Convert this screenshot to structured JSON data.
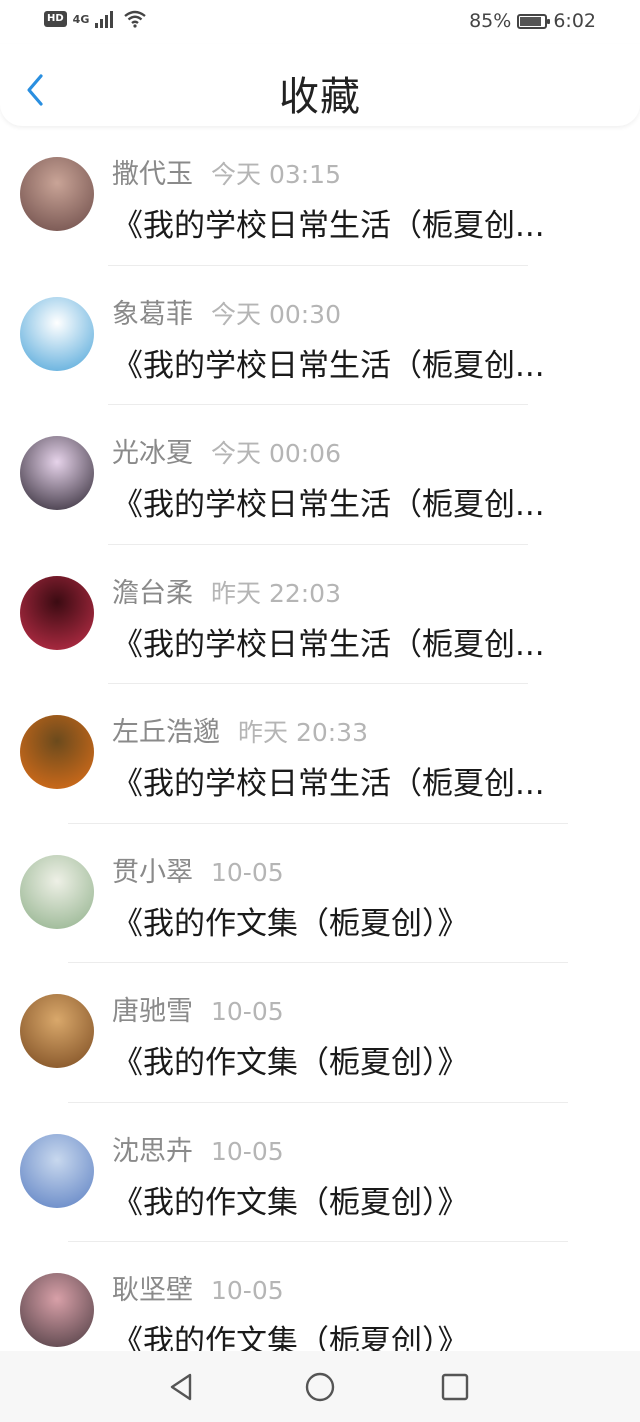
{
  "status_bar": {
    "hd": "HD",
    "network": "4G",
    "battery_percent": "85%",
    "battery_level": 0.85,
    "time": "6:02"
  },
  "header": {
    "title": "收藏",
    "back_icon": "chevron-left-icon"
  },
  "favorites": [
    {
      "name": "撒代玉",
      "time": "今天 03:15",
      "work": "《我的学校日常生活（栀夏创...",
      "avatar_colors": [
        "#c9a497",
        "#6b4a47"
      ]
    },
    {
      "name": "象葛菲",
      "time": "今天 00:30",
      "work": "《我的学校日常生活（栀夏创...",
      "avatar_colors": [
        "#ffffff",
        "#4aa3d8"
      ]
    },
    {
      "name": "光冰夏",
      "time": "今天 00:06",
      "work": "《我的学校日常生活（栀夏创...",
      "avatar_colors": [
        "#e6d3ea",
        "#2b2430"
      ]
    },
    {
      "name": "澹台柔",
      "time": "昨天 22:03",
      "work": "《我的学校日常生活（栀夏创...",
      "avatar_colors": [
        "#3b0b12",
        "#c2304a"
      ]
    },
    {
      "name": "左丘浩邈",
      "time": "昨天 20:33",
      "work": "《我的学校日常生活（栀夏创...",
      "avatar_colors": [
        "#6b4a1c",
        "#e0701a"
      ]
    },
    {
      "name": "贯小翠",
      "time": "10-05",
      "work": "《我的作文集（栀夏创）》",
      "avatar_colors": [
        "#eef0e6",
        "#8fb08a"
      ]
    },
    {
      "name": "唐驰雪",
      "time": "10-05",
      "work": "《我的作文集（栀夏创）》",
      "avatar_colors": [
        "#d9a86b",
        "#7a4a20"
      ]
    },
    {
      "name": "沈思卉",
      "time": "10-05",
      "work": "《我的作文集（栀夏创）》",
      "avatar_colors": [
        "#c8d8ee",
        "#5b7fc2"
      ]
    },
    {
      "name": "耿坚壁",
      "time": "10-05",
      "work": "《我的作文集（栀夏创）》",
      "avatar_colors": [
        "#d8a0a8",
        "#4a3a40"
      ]
    }
  ],
  "nav_bar": {
    "back": "triangle-back-icon",
    "home": "circle-home-icon",
    "recents": "square-recents-icon"
  }
}
